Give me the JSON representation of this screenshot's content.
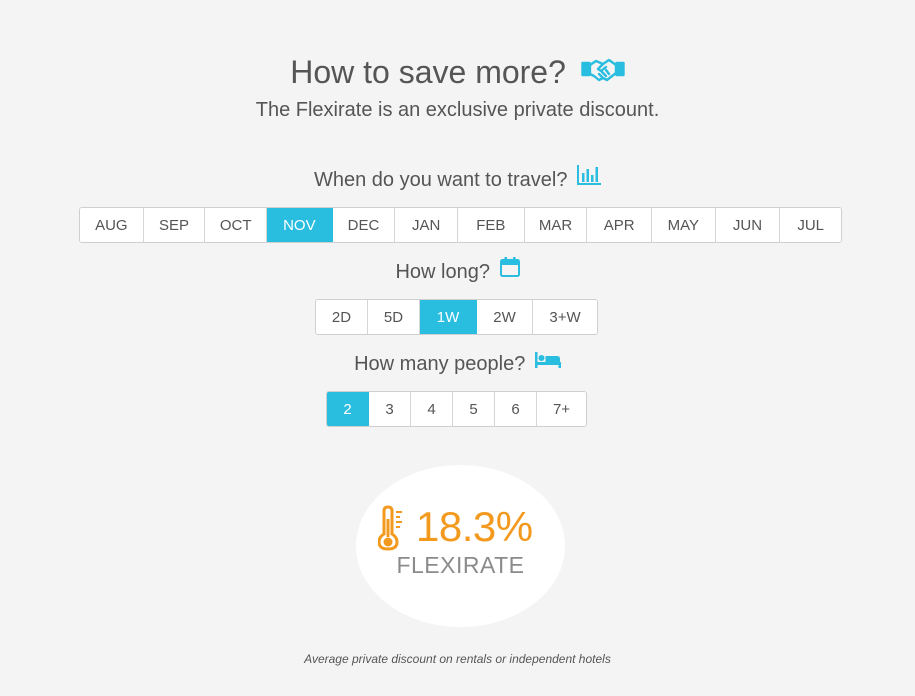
{
  "header": {
    "title": "How to save more?",
    "subtitle": "The Flexirate is an exclusive private discount.",
    "title_icon": "handshake-icon"
  },
  "travel_month": {
    "question": "When do you want to travel?",
    "icon": "bar-chart-icon",
    "options": [
      "AUG",
      "SEP",
      "OCT",
      "NOV",
      "DEC",
      "JAN",
      "FEB",
      "MAR",
      "APR",
      "MAY",
      "JUN",
      "JUL"
    ],
    "selected": "NOV"
  },
  "duration": {
    "question": "How long?",
    "icon": "calendar-icon",
    "options": [
      "2D",
      "5D",
      "1W",
      "2W",
      "3+W"
    ],
    "selected": "1W"
  },
  "people": {
    "question": "How many people?",
    "icon": "bed-icon",
    "options": [
      "2",
      "3",
      "4",
      "5",
      "6",
      "7+"
    ],
    "selected": "2"
  },
  "flexirate": {
    "value": "18.3%",
    "label": "FLEXIRATE",
    "icon": "thermometer-icon"
  },
  "footnote": "Average private discount on rentals or independent hotels",
  "colors": {
    "accent": "#29bde0",
    "rate": "#f39a1e",
    "background": "#f4f4f4",
    "text": "#555555"
  }
}
